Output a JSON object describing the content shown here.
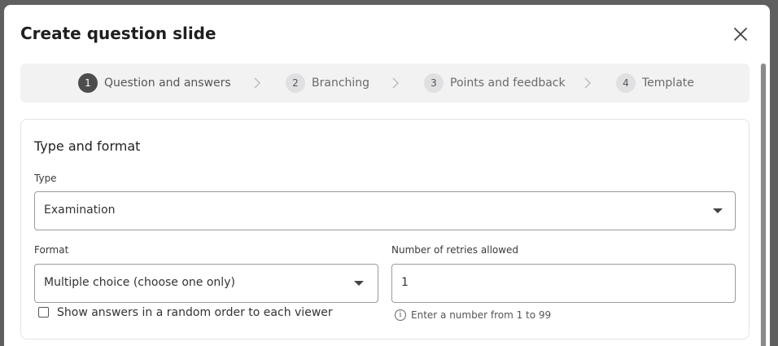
{
  "dialog": {
    "title": "Create question slide"
  },
  "stepper": {
    "steps": [
      {
        "number": "1",
        "label": "Question and answers",
        "active": true
      },
      {
        "number": "2",
        "label": "Branching",
        "active": false
      },
      {
        "number": "3",
        "label": "Points and feedback",
        "active": false
      },
      {
        "number": "4",
        "label": "Template",
        "active": false
      }
    ]
  },
  "type_and_format": {
    "section_title": "Type and format",
    "type": {
      "label": "Type",
      "value": "Examination"
    },
    "format": {
      "label": "Format",
      "value": "Multiple choice (choose one only)"
    },
    "retries": {
      "label": "Number of retries allowed",
      "value": "1",
      "hint": "Enter a number from 1 to 99"
    },
    "random_order": {
      "label": "Show answers in a random order to each viewer",
      "checked": false
    }
  },
  "icons": {
    "close": "close-icon",
    "dropdown": "chevron-down-icon",
    "separator": "chevron-right-icon",
    "info": "info-icon"
  }
}
